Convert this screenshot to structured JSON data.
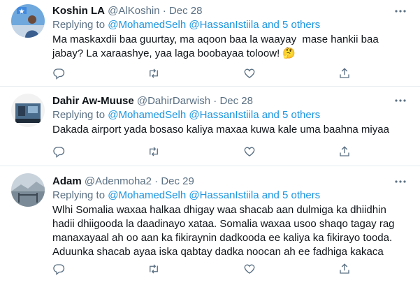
{
  "colors": {
    "text": "#0f1419",
    "secondary": "#5b7083",
    "link": "#1b95e0",
    "divider": "#e6ecf0"
  },
  "icons": {
    "reply": "reply-icon",
    "retweet": "retweet-icon",
    "like": "heart-icon",
    "share": "share-icon",
    "more": "more-horizontal-icon"
  },
  "tweets": [
    {
      "display_name": "Koshin LA",
      "handle": "@AlKoshin",
      "separator": "·",
      "date": "Dec 28",
      "replying_prefix": "Replying to",
      "mention1": "@MohamedSelh",
      "mention2": "@HassanIstiila",
      "others": "and 5 others",
      "text": "Ma maskaxdii baa guurtay, ma aqoon baa la waayay  mase hankii baa jabay? La xaraashye, yaa laga boobayaa toloow! 🤔"
    },
    {
      "display_name": "Dahir Aw-Muuse",
      "handle": "@DahirDarwish",
      "separator": "·",
      "date": "Dec 28",
      "replying_prefix": "Replying to",
      "mention1": "@MohamedSelh",
      "mention2": "@HassanIstiila",
      "others": "and 5 others",
      "text": "Dakada airport yada bosaso kaliya maxaa kuwa kale uma baahna miyaa"
    },
    {
      "display_name": "Adam",
      "handle": "@Adenmoha2",
      "separator": "·",
      "date": "Dec 29",
      "replying_prefix": "Replying to",
      "mention1": "@MohamedSelh",
      "mention2": "@HassanIstiila",
      "others": "and 5 others",
      "text": "Wlhi Somalia waxaa halkaa dhigay waa shacab aan dulmiga ka dhiidhin hadii dhiigooda la daadinayo xataa. Somalia waxaa usoo shaqo tagay rag manaxayaal ah oo aan ka fikiraynin dadkooda ee kaliya ka fikirayo tooda. Aduunka shacab ayaa iska qabtay dadka noocan ah ee fadhiga kakaca"
    }
  ]
}
